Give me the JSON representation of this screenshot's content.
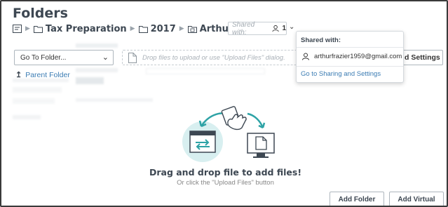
{
  "page": {
    "title": "Folders"
  },
  "breadcrumb": {
    "items": [
      {
        "label": "Tax Preparation"
      },
      {
        "label": "2017"
      },
      {
        "label": "Arthur Frazier"
      }
    ]
  },
  "shared": {
    "placeholder": "Shared with:",
    "count": "1"
  },
  "toolbar": {
    "goto_label": "Go To Folder...",
    "drop_hint": "Drop files to upload or use \"Upload Files\" dialog.",
    "settings_label": "d Settings"
  },
  "sidebar": {
    "parent_folder": "Parent Folder"
  },
  "popover": {
    "header": "Shared with:",
    "email": "arthurfrazier1959@gmail.com",
    "link": "Go to Sharing and Settings"
  },
  "dropzone": {
    "title": "Drag and drop file to add files!",
    "subtitle": "Or click the \"Upload Files\" button"
  },
  "buttons": {
    "add_folder": "Add Folder",
    "add_virtual": "Add Virtual"
  },
  "colors": {
    "accent": "#3b7cb3",
    "teal": "#2ea3a6",
    "text": "#3d4752"
  }
}
